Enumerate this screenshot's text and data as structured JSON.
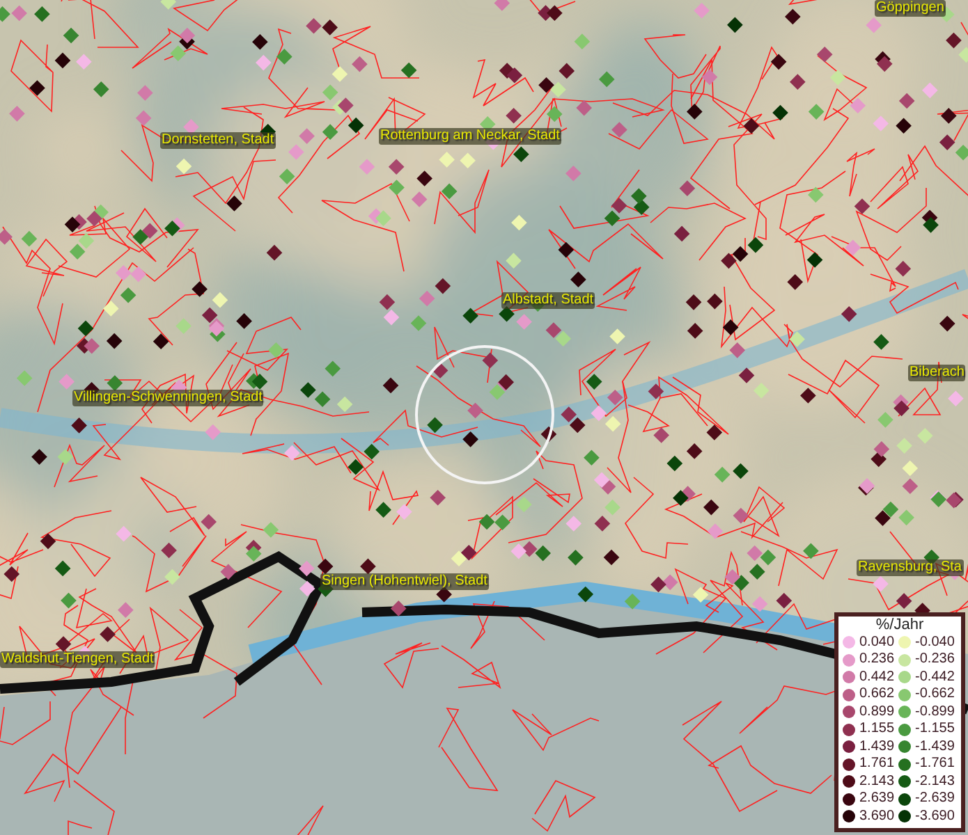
{
  "map": {
    "places": [
      {
        "name": "Göppingen"
      },
      {
        "name": "Dornstetten, Stadt"
      },
      {
        "name": "Rottenburg am Neckar, Stadt"
      },
      {
        "name": "Albstadt, Stadt"
      },
      {
        "name": "Biberach"
      },
      {
        "name": "Villingen-Schwenningen, Stadt"
      },
      {
        "name": "Singen (Hohentwiel), Stadt"
      },
      {
        "name": "Ravensburg, Sta"
      },
      {
        "name": "Waldshut-Tiengen, Stadt"
      }
    ]
  },
  "legend": {
    "title": "%/Jahr",
    "positive": [
      {
        "label": "0.040",
        "color": "#f4b8e6"
      },
      {
        "label": "0.236",
        "color": "#e59ac9"
      },
      {
        "label": "0.442",
        "color": "#d17aa8"
      },
      {
        "label": "0.662",
        "color": "#bd5f88"
      },
      {
        "label": "0.899",
        "color": "#a8476d"
      },
      {
        "label": "1.155",
        "color": "#8f3050"
      },
      {
        "label": "1.439",
        "color": "#7a2040"
      },
      {
        "label": "1.761",
        "color": "#641528"
      },
      {
        "label": "2.143",
        "color": "#4e0c18"
      },
      {
        "label": "2.639",
        "color": "#3a0610"
      },
      {
        "label": "3.690",
        "color": "#260308"
      }
    ],
    "negative": [
      {
        "label": "-0.040",
        "color": "#eef5b0"
      },
      {
        "label": "-0.236",
        "color": "#c8e6a0"
      },
      {
        "label": "-0.442",
        "color": "#a8d88a"
      },
      {
        "label": "-0.662",
        "color": "#88c870"
      },
      {
        "label": "-0.899",
        "color": "#68b458"
      },
      {
        "label": "-1.155",
        "color": "#4a9a40"
      },
      {
        "label": "-1.439",
        "color": "#378530"
      },
      {
        "label": "-1.761",
        "color": "#257020"
      },
      {
        "label": "-2.143",
        "color": "#155a14"
      },
      {
        "label": "-2.639",
        "color": "#0b460b"
      },
      {
        "label": "-3.690",
        "color": "#053205"
      }
    ]
  }
}
